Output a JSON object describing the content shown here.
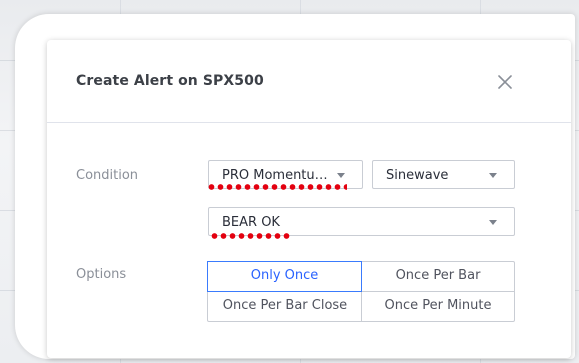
{
  "dialog": {
    "title": "Create Alert on SPX500",
    "close_icon": "close-icon"
  },
  "condition": {
    "label": "Condition",
    "indicator_select": {
      "value": "PRO Momentu…"
    },
    "plot_select": {
      "value": "Sinewave"
    },
    "signal_select": {
      "value": "BEAR OK"
    }
  },
  "options": {
    "label": "Options",
    "choices": [
      {
        "label": "Only Once",
        "selected": true
      },
      {
        "label": "Once Per Bar",
        "selected": false
      },
      {
        "label": "Once Per Bar Close",
        "selected": false
      },
      {
        "label": "Once Per Minute",
        "selected": false
      }
    ]
  },
  "colors": {
    "accent": "#2962ff",
    "annotation": "#e3000f"
  }
}
